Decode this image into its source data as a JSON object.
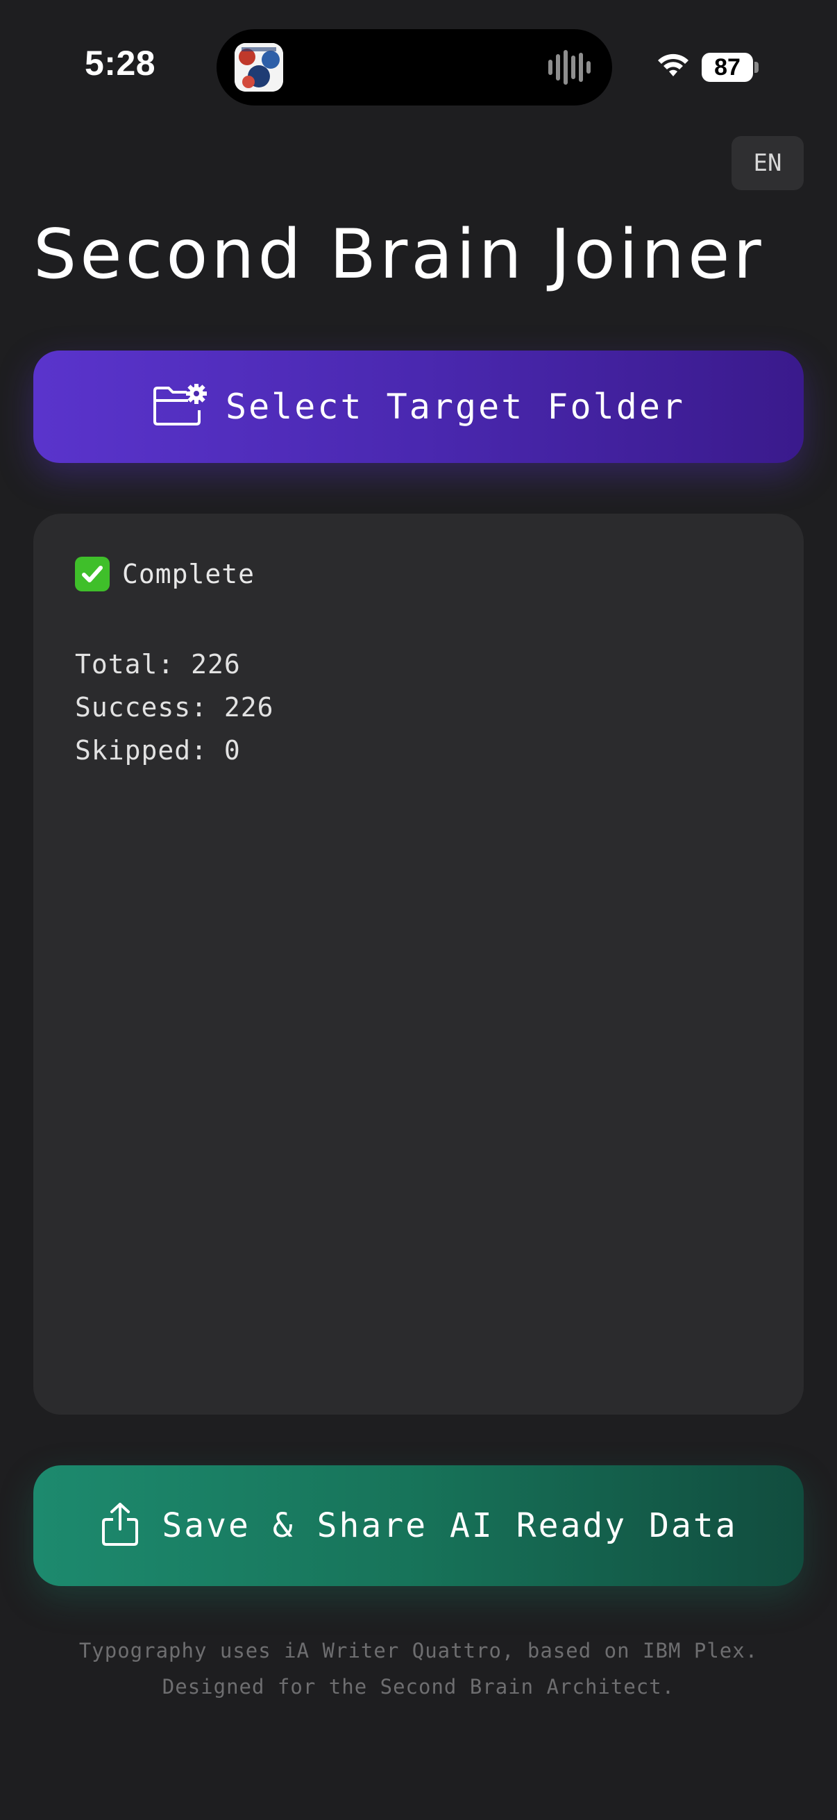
{
  "status_bar": {
    "time": "5:28",
    "battery": "87"
  },
  "language": {
    "label": "EN"
  },
  "title": "Second Brain Joiner",
  "select_button": {
    "label": "Select Target Folder",
    "icon": "folder-gear-icon"
  },
  "result_panel": {
    "status_icon": "check-mark-icon",
    "status_text": "Complete",
    "stats": [
      "Total: 226",
      "Success: 226",
      "Skipped: 0"
    ]
  },
  "share_button": {
    "label": "Save & Share AI Ready Data",
    "icon": "share-icon"
  },
  "footer": {
    "line1": "Typography uses iA Writer Quattro, based on IBM Plex.",
    "line2": "Designed for the Second Brain Architect."
  },
  "colors": {
    "background": "#1e1e20",
    "primary_button": "#5a34cc",
    "share_button": "#1d8a6e",
    "panel": "#2b2b2d"
  }
}
